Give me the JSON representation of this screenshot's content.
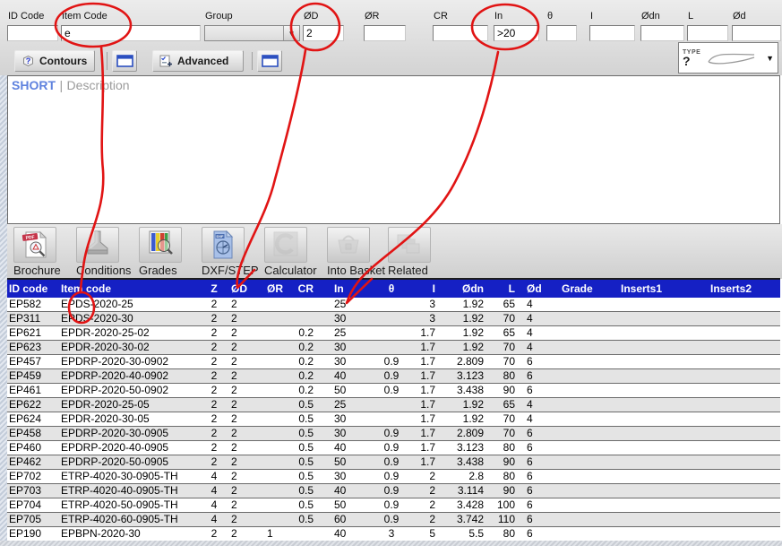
{
  "filter_bar": {
    "fields": [
      {
        "label": "ID Code",
        "value": ""
      },
      {
        "label": "Item Code",
        "value": "e"
      },
      {
        "label": "Group",
        "value": ""
      },
      {
        "label": "ØD",
        "value": "2"
      },
      {
        "label": "ØR",
        "value": ""
      },
      {
        "label": "CR",
        "value": ""
      },
      {
        "label": "In",
        "value": ">20"
      },
      {
        "label": "θ",
        "value": ""
      },
      {
        "label": "I",
        "value": ""
      },
      {
        "label": "Ødn",
        "value": ""
      },
      {
        "label": "L",
        "value": ""
      },
      {
        "label": "Ød",
        "value": ""
      }
    ]
  },
  "toolbar": {
    "contours_label": "Contours",
    "advanced_label": "Advanced",
    "type_label": "TYPE",
    "type_question": "?",
    "dropdown_glyph": "▼"
  },
  "preview_panel": {
    "view_mode": "SHORT",
    "divider": "|",
    "description_label": "Description"
  },
  "actions": [
    {
      "label": "Brochure",
      "enabled": true
    },
    {
      "label": "Conditions",
      "enabled": true
    },
    {
      "label": "Grades",
      "enabled": true
    },
    {
      "label": "DXF/STEP",
      "enabled": true
    },
    {
      "label": "Calculator",
      "enabled": false
    },
    {
      "label": "Into Basket",
      "enabled": false
    },
    {
      "label": "Related",
      "enabled": false
    }
  ],
  "table": {
    "columns": [
      "ID code",
      "Item code",
      "Z",
      "ØD",
      "ØR",
      "CR",
      "In",
      "θ",
      "I",
      "Ødn",
      "L",
      "Ød",
      "Grade",
      "Inserts1",
      "Inserts2"
    ],
    "rows": [
      [
        "EP582",
        "EPDS-2020-25",
        "2",
        "2",
        "",
        "",
        "25",
        "",
        "3",
        "1.92",
        "65",
        "4",
        "",
        "",
        ""
      ],
      [
        "EP311",
        "EPDS-2020-30",
        "2",
        "2",
        "",
        "",
        "30",
        "",
        "3",
        "1.92",
        "70",
        "4",
        "",
        "",
        ""
      ],
      [
        "EP621",
        "EPDR-2020-25-02",
        "2",
        "2",
        "",
        "0.2",
        "25",
        "",
        "1.7",
        "1.92",
        "65",
        "4",
        "",
        "",
        ""
      ],
      [
        "EP623",
        "EPDR-2020-30-02",
        "2",
        "2",
        "",
        "0.2",
        "30",
        "",
        "1.7",
        "1.92",
        "70",
        "4",
        "",
        "",
        ""
      ],
      [
        "EP457",
        "EPDRP-2020-30-0902",
        "2",
        "2",
        "",
        "0.2",
        "30",
        "0.9",
        "1.7",
        "2.809",
        "70",
        "6",
        "",
        "",
        ""
      ],
      [
        "EP459",
        "EPDRP-2020-40-0902",
        "2",
        "2",
        "",
        "0.2",
        "40",
        "0.9",
        "1.7",
        "3.123",
        "80",
        "6",
        "",
        "",
        ""
      ],
      [
        "EP461",
        "EPDRP-2020-50-0902",
        "2",
        "2",
        "",
        "0.2",
        "50",
        "0.9",
        "1.7",
        "3.438",
        "90",
        "6",
        "",
        "",
        ""
      ],
      [
        "EP622",
        "EPDR-2020-25-05",
        "2",
        "2",
        "",
        "0.5",
        "25",
        "",
        "1.7",
        "1.92",
        "65",
        "4",
        "",
        "",
        ""
      ],
      [
        "EP624",
        "EPDR-2020-30-05",
        "2",
        "2",
        "",
        "0.5",
        "30",
        "",
        "1.7",
        "1.92",
        "70",
        "4",
        "",
        "",
        ""
      ],
      [
        "EP458",
        "EPDRP-2020-30-0905",
        "2",
        "2",
        "",
        "0.5",
        "30",
        "0.9",
        "1.7",
        "2.809",
        "70",
        "6",
        "",
        "",
        ""
      ],
      [
        "EP460",
        "EPDRP-2020-40-0905",
        "2",
        "2",
        "",
        "0.5",
        "40",
        "0.9",
        "1.7",
        "3.123",
        "80",
        "6",
        "",
        "",
        ""
      ],
      [
        "EP462",
        "EPDRP-2020-50-0905",
        "2",
        "2",
        "",
        "0.5",
        "50",
        "0.9",
        "1.7",
        "3.438",
        "90",
        "6",
        "",
        "",
        ""
      ],
      [
        "EP702",
        "ETRP-4020-30-0905-TH",
        "4",
        "2",
        "",
        "0.5",
        "30",
        "0.9",
        "2",
        "2.8",
        "80",
        "6",
        "",
        "",
        ""
      ],
      [
        "EP703",
        "ETRP-4020-40-0905-TH",
        "4",
        "2",
        "",
        "0.5",
        "40",
        "0.9",
        "2",
        "3.114",
        "90",
        "6",
        "",
        "",
        ""
      ],
      [
        "EP704",
        "ETRP-4020-50-0905-TH",
        "4",
        "2",
        "",
        "0.5",
        "50",
        "0.9",
        "2",
        "3.428",
        "100",
        "6",
        "",
        "",
        ""
      ],
      [
        "EP705",
        "ETRP-4020-60-0905-TH",
        "4",
        "2",
        "",
        "0.5",
        "60",
        "0.9",
        "2",
        "3.742",
        "110",
        "6",
        "",
        "",
        ""
      ],
      [
        "EP190",
        "EPBPN-2020-30",
        "2",
        "2",
        "1",
        "",
        "40",
        "3",
        "5",
        "5.5",
        "80",
        "6",
        "",
        "",
        ""
      ]
    ]
  },
  "annotations": {
    "color": "#e11414",
    "targets": [
      "item-code-filter",
      "od-filter",
      "in-filter",
      "od-column-header",
      "in-column-value-25",
      "row-ep582-item-code"
    ]
  }
}
